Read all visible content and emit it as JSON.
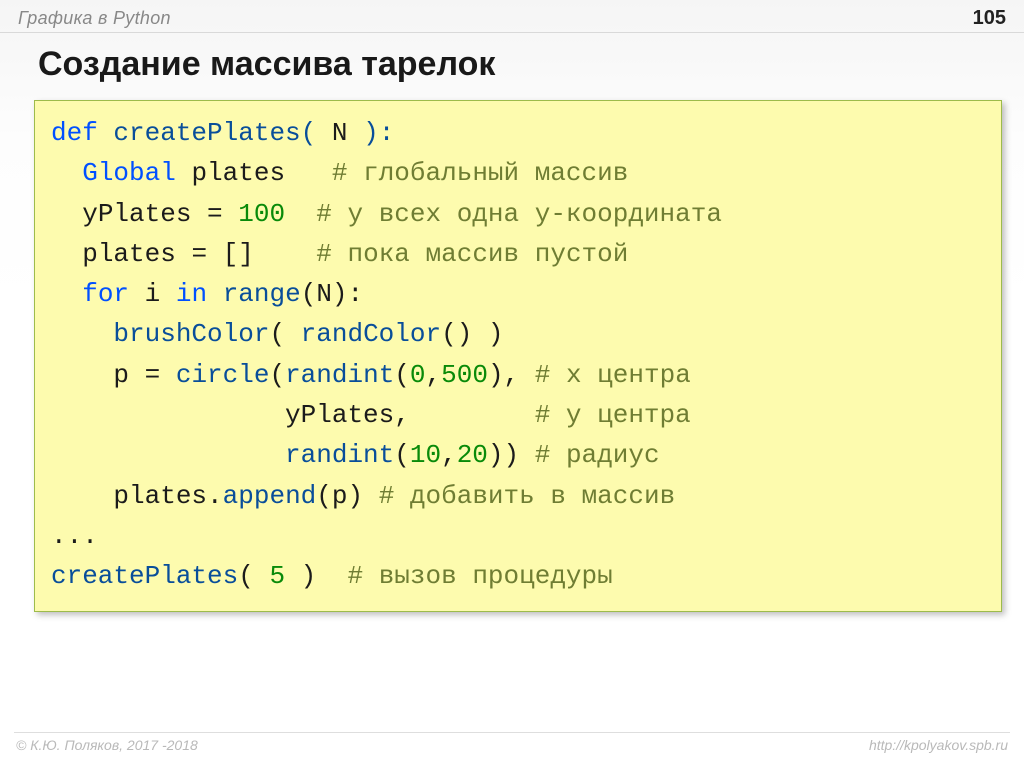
{
  "header": {
    "breadcrumb": "Графика в Python",
    "page": "105"
  },
  "title": "Создание массива тарелок",
  "code": {
    "t": {
      "def": "def",
      "global": "Global",
      "for": "for",
      "in": "in",
      "createPlates": "createPlates",
      "plates": "plates",
      "yPlates": "yPlates",
      "range": "range",
      "brushColor": "brushColor",
      "randColor": "randColor",
      "circle": "circle",
      "randint": "randint",
      "append": "append",
      "p": "p",
      "i": "i",
      "N": "N",
      "num100": "100",
      "num0": "0",
      "num500": "500",
      "num10": "10",
      "num20": "20",
      "num5": "5",
      "ellipsis": "...",
      "eq": " = ",
      "empty": "[]"
    },
    "c": {
      "c1": "# глобальный массив",
      "c2": "# у всех одна y-координата",
      "c3": "# пока массив пустой",
      "c4": "# x центра",
      "c5": "# y центра",
      "c6": "# радиус",
      "c7": "# добавить в массив",
      "c8": "# вызов процедуры"
    }
  },
  "footer": {
    "left": "© К.Ю. Поляков, 2017 -2018",
    "right": "http://kpolyakov.spb.ru"
  }
}
